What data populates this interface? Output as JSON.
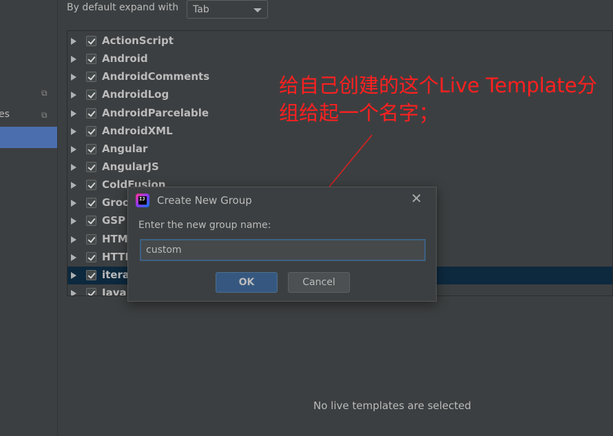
{
  "left_pane": {
    "items": [
      {
        "label": "",
        "icon": "copy-icon"
      },
      {
        "label": "es",
        "icon": "copy-icon"
      }
    ]
  },
  "settings": {
    "expand_label": "By default expand with",
    "expand_value": "Tab"
  },
  "tree": {
    "groups": [
      {
        "label": "ActionScript",
        "checked": true
      },
      {
        "label": "Android",
        "checked": true
      },
      {
        "label": "AndroidComments",
        "checked": true
      },
      {
        "label": "AndroidLog",
        "checked": true
      },
      {
        "label": "AndroidParcelable",
        "checked": true
      },
      {
        "label": "AndroidXML",
        "checked": true
      },
      {
        "label": "Angular",
        "checked": true
      },
      {
        "label": "AngularJS",
        "checked": true
      },
      {
        "label": "ColdFusion",
        "checked": true
      },
      {
        "label": "Groo",
        "checked": true
      },
      {
        "label": "GSP",
        "checked": true
      },
      {
        "label": "HTML",
        "checked": true
      },
      {
        "label": "HTTP",
        "checked": true
      },
      {
        "label": "iterat",
        "checked": true,
        "selected": true
      },
      {
        "label": "Java",
        "checked": true
      }
    ]
  },
  "status": {
    "no_selection": "No live templates are selected"
  },
  "annotation": {
    "text": "给自己创建的这个Live Template分组给起一个名字；",
    "color": "#ff2020"
  },
  "dialog": {
    "title": "Create New Group",
    "close_icon": "close-icon",
    "prompt": "Enter the new group name:",
    "input_value": "custom",
    "ok_label": "OK",
    "cancel_label": "Cancel"
  },
  "colors": {
    "selection": "#4b6eaf",
    "tree_selection": "#0d293e",
    "ok_button": "#365880"
  }
}
